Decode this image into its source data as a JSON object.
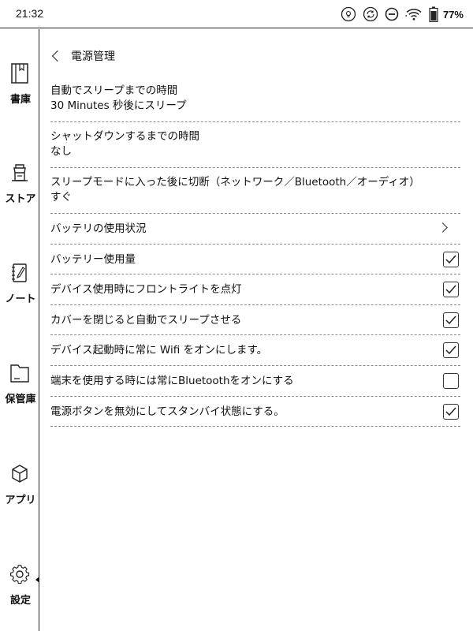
{
  "status_bar": {
    "time": "21:32",
    "icons": [
      "lightbulb-icon",
      "sync-icon",
      "do-not-disturb-icon",
      "wifi-icon",
      "battery-icon"
    ],
    "battery_percent": "77%"
  },
  "sidebar": {
    "items": [
      {
        "icon": "book-icon",
        "label": "書庫"
      },
      {
        "icon": "store-icon",
        "label": "ストア"
      },
      {
        "icon": "note-icon",
        "label": "ノート"
      },
      {
        "icon": "folder-icon",
        "label": "保管庫"
      },
      {
        "icon": "cube-icon",
        "label": "アプリ"
      },
      {
        "icon": "gear-icon",
        "label": "設定",
        "active": true
      }
    ]
  },
  "page": {
    "title": "電源管理"
  },
  "settings": [
    {
      "title": "自動でスリープまでの時間",
      "value": "30 Minutes 秒後にスリープ"
    },
    {
      "title": "シャットダウンするまでの時間",
      "value": "なし"
    },
    {
      "title": "スリープモードに入った後に切断（ネットワーク／Bluetooth／オーディオ）",
      "value": "すぐ"
    },
    {
      "title": "バッテリの使用状況",
      "control": "chevron"
    },
    {
      "title": "バッテリー使用量",
      "control": "checkbox",
      "checked": true
    },
    {
      "title": "デバイス使用時にフロントライトを点灯",
      "control": "checkbox",
      "checked": true
    },
    {
      "title": "カバーを閉じると自動でスリープさせる",
      "control": "checkbox",
      "checked": true
    },
    {
      "title": "デバイス起動時に常に Wifi をオンにします。",
      "control": "checkbox",
      "checked": true
    },
    {
      "title": "端末を使用する時には常にBluetoothをオンにする",
      "control": "checkbox",
      "checked": false
    },
    {
      "title": "電源ボタンを無効にしてスタンバイ状態にする。",
      "control": "checkbox",
      "checked": true
    }
  ]
}
